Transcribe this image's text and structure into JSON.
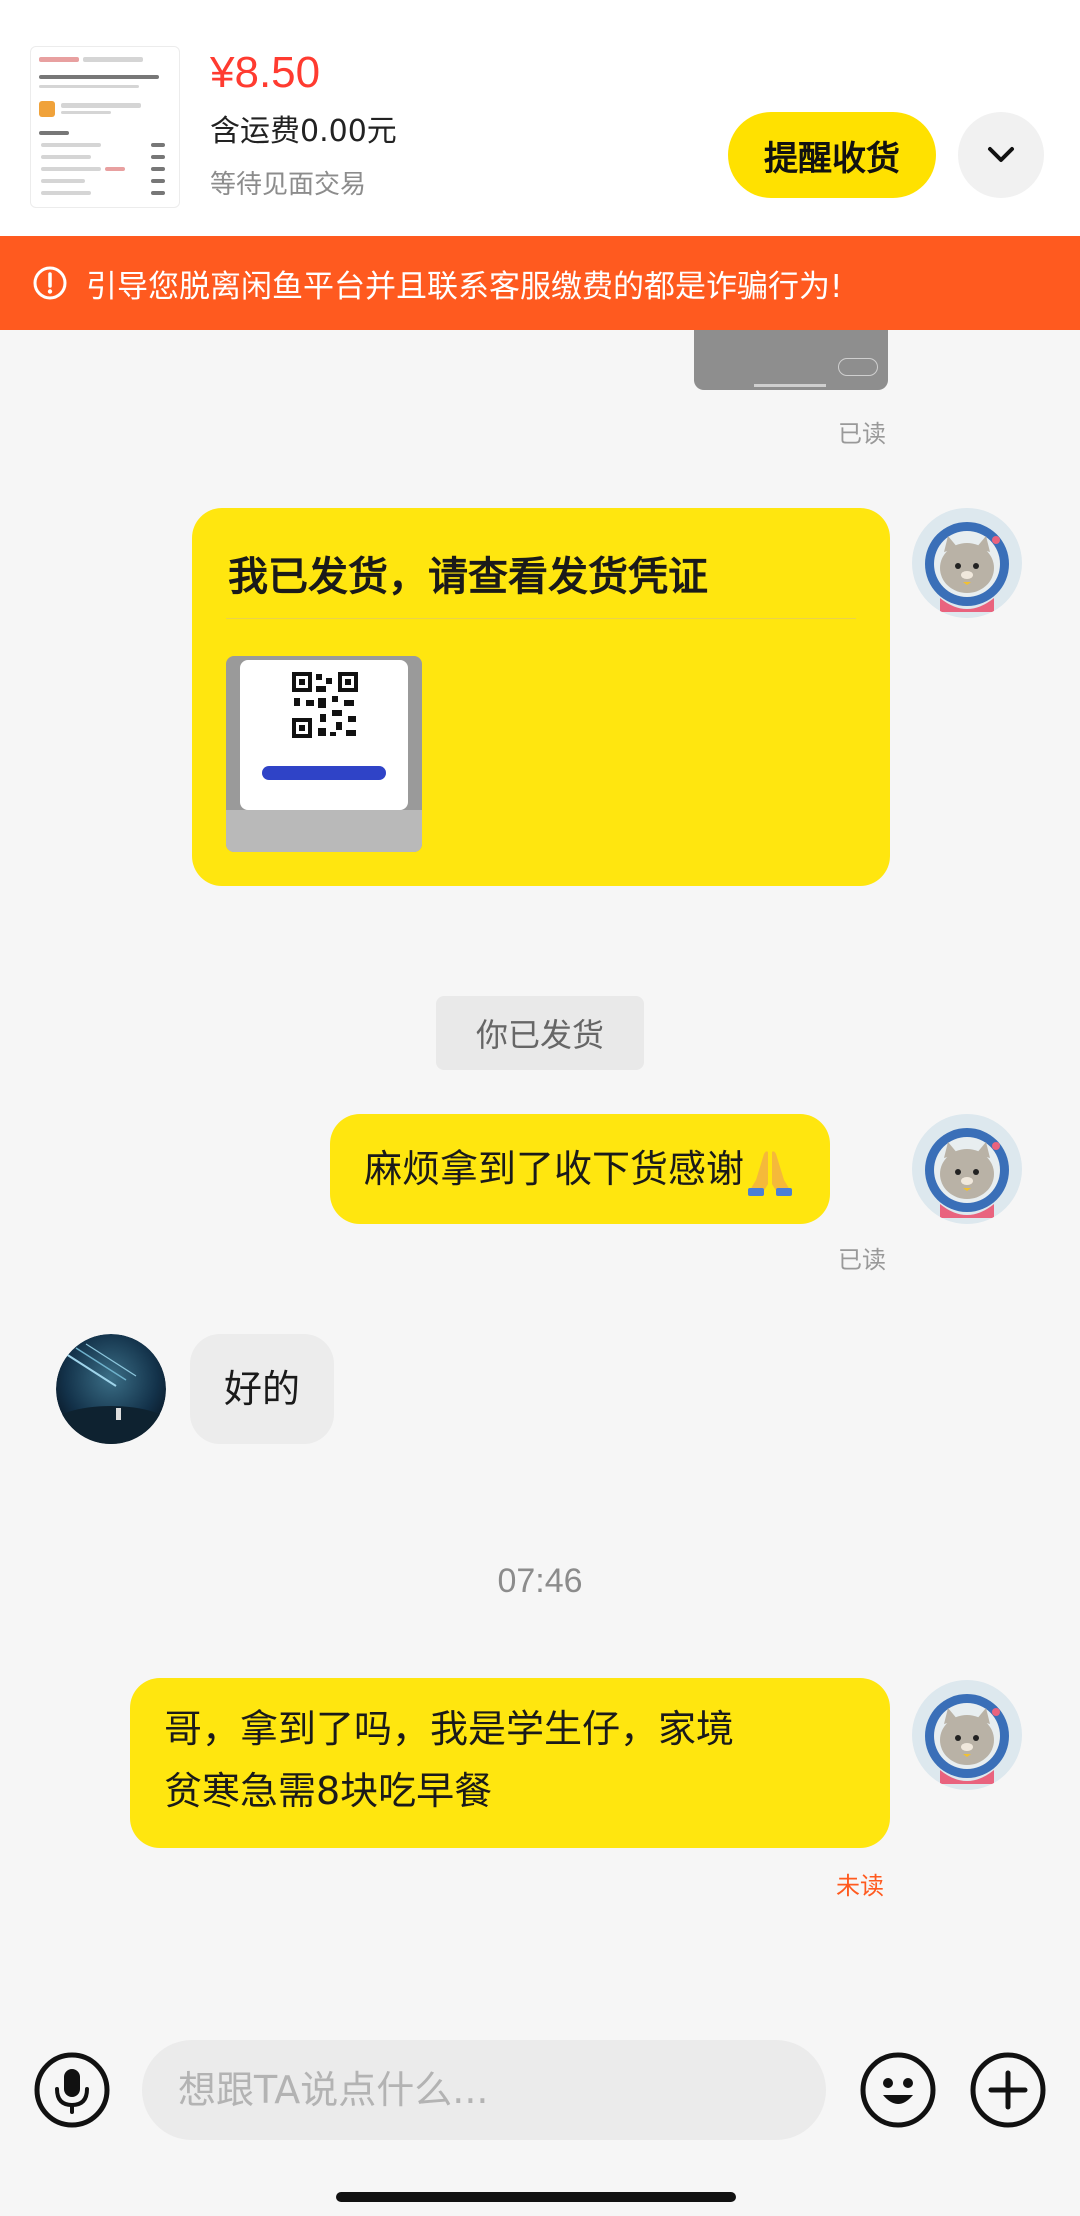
{
  "header": {
    "price": "¥8.50",
    "shipping": "含运费0.00元",
    "status": "等待见面交易",
    "remind_button": "提醒收货",
    "expand_icon": "chevron-down-icon"
  },
  "warning": {
    "text": "引导您脱离闲鱼平台并且联系客服缴费的都是诈骗行为!",
    "icon": "alert-circle-icon"
  },
  "chat": {
    "read_label_1": "已读",
    "shipment_card": {
      "title": "我已发货，请查看发货凭证"
    },
    "system_notice": "你已发货",
    "message_1": "麻烦拿到了收下货感谢",
    "read_label_2": "已读",
    "reply_1": "好的",
    "timestamp": "07:46",
    "message_2_line_1": "哥，拿到了吗，我是学生仔，家境",
    "message_2_line_2": "贫寒急需8块吃早餐",
    "unread_label": "未读"
  },
  "input_bar": {
    "placeholder": "想跟TA说点什么...",
    "voice_icon": "microphone-icon",
    "emoji_icon": "emoji-icon",
    "plus_icon": "plus-icon"
  },
  "colors": {
    "accent_yellow": "#ffe60f",
    "warning_orange": "#ff5a1f",
    "price_red": "#ff3b30"
  }
}
